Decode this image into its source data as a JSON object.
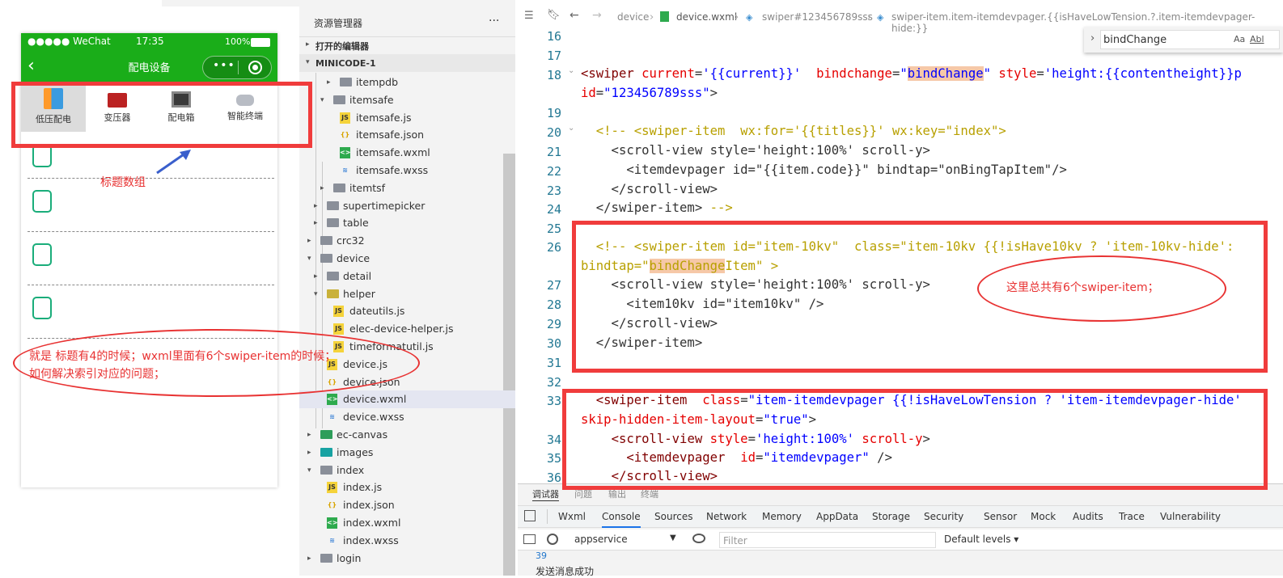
{
  "phone": {
    "carrier": "●●●●● WeChat",
    "time": "17:35",
    "battery": "100%",
    "title": "配电设备",
    "tabs": [
      {
        "label": "低压配电",
        "icon": "low-voltage-cabinet-icon",
        "selected": true
      },
      {
        "label": "变压器",
        "icon": "transformer-icon",
        "selected": false
      },
      {
        "label": "配电箱",
        "icon": "distribution-box-icon",
        "selected": false
      },
      {
        "label": "智能终端",
        "icon": "smart-terminal-icon",
        "selected": false
      }
    ]
  },
  "explorer": {
    "title": "资源管理器",
    "more": "···",
    "open_editors": "打开的编辑器",
    "project": "MINICODE-1",
    "items": [
      {
        "label": "itempdb",
        "kind": "folder"
      },
      {
        "label": "itemsafe",
        "kind": "folder-open"
      },
      {
        "label": "itemsafe.js",
        "kind": "js"
      },
      {
        "label": "itemsafe.json",
        "kind": "json"
      },
      {
        "label": "itemsafe.wxml",
        "kind": "wxml"
      },
      {
        "label": "itemsafe.wxss",
        "kind": "wxss"
      },
      {
        "label": "itemtsf",
        "kind": "folder"
      },
      {
        "label": "supertimepicker",
        "kind": "folder"
      },
      {
        "label": "table",
        "kind": "folder"
      },
      {
        "label": "crc32",
        "kind": "folder"
      },
      {
        "label": "device",
        "kind": "folder-open"
      },
      {
        "label": "detail",
        "kind": "folder"
      },
      {
        "label": "helper",
        "kind": "folder-open"
      },
      {
        "label": "dateutils.js",
        "kind": "js"
      },
      {
        "label": "elec-device-helper.js",
        "kind": "js"
      },
      {
        "label": "timeformatutil.js",
        "kind": "js"
      },
      {
        "label": "device.js",
        "kind": "js"
      },
      {
        "label": "device.json",
        "kind": "json"
      },
      {
        "label": "device.wxml",
        "kind": "wxml"
      },
      {
        "label": "device.wxss",
        "kind": "wxss"
      },
      {
        "label": "ec-canvas",
        "kind": "folder"
      },
      {
        "label": "images",
        "kind": "folder"
      },
      {
        "label": "index",
        "kind": "folder-open"
      },
      {
        "label": "index.js",
        "kind": "js"
      },
      {
        "label": "index.json",
        "kind": "json"
      },
      {
        "label": "index.wxml",
        "kind": "wxml"
      },
      {
        "label": "index.wxss",
        "kind": "wxss"
      },
      {
        "label": "login",
        "kind": "folder"
      }
    ]
  },
  "editor": {
    "breadcrumb": {
      "b1": "device",
      "b2": "device.wxml",
      "b3": "swiper#123456789sss",
      "b4": "swiper-item.item-itemdevpager.{{isHaveLowTension.?.item-itemdevpager-hide:}}"
    },
    "find_value": "bindChange",
    "find_case": "Aa",
    "find_word": "Abl",
    "line_numbers": [
      "16",
      "17",
      "18",
      "",
      "19",
      "20",
      "21",
      "22",
      "23",
      "24",
      "25",
      "26",
      "",
      "27",
      "28",
      "29",
      "30",
      "31",
      "32",
      "33",
      "",
      "34",
      "35",
      "36"
    ]
  },
  "devtools": {
    "top_tabs": [
      "调试器",
      "问题",
      "输出",
      "终端"
    ],
    "tabs": [
      "Wxml",
      "Console",
      "Sources",
      "Network",
      "Memory",
      "AppData",
      "Storage",
      "Security",
      "Sensor",
      "Mock",
      "Audits",
      "Trace",
      "Vulnerability"
    ],
    "active_tab": "Console",
    "context": "appservice",
    "filter_placeholder": "Filter",
    "levels": "Default levels ▾",
    "console_line": "39",
    "console_msg": "发送消息成功"
  },
  "annotations": {
    "title_array": "标题数组",
    "six_items": "这里总共有6个swiper-item；",
    "question_line1": "就是 标题有4的时候；wxml里面有6个swiper-item的时候；",
    "question_line2": "如何解决索引对应的问题；"
  },
  "colors": {
    "wechat_green": "#1aad19",
    "annotation_red": "#f03c3c"
  }
}
